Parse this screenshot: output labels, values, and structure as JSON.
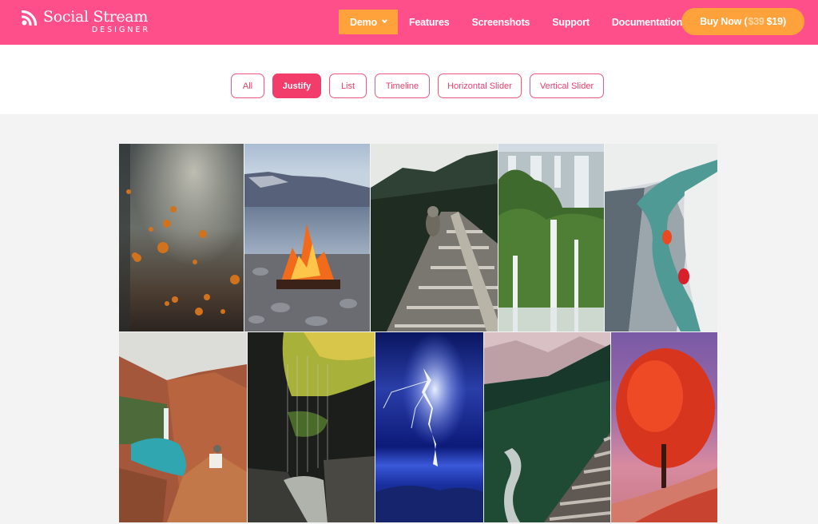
{
  "header": {
    "logo": {
      "title": "Social Stream",
      "subtitle": "DESIGNER",
      "icon": "rss-icon"
    },
    "nav": [
      {
        "label": "Demo",
        "has_dropdown": true,
        "active": true
      },
      {
        "label": "Features",
        "has_dropdown": false,
        "active": false
      },
      {
        "label": "Screenshots",
        "has_dropdown": false,
        "active": false
      },
      {
        "label": "Support",
        "has_dropdown": false,
        "active": false
      },
      {
        "label": "Documentation",
        "has_dropdown": true,
        "active": false
      }
    ],
    "buy": {
      "prefix": "Buy Now (",
      "old_price": "$39",
      "new_price": "$19",
      "suffix": ")"
    }
  },
  "filters": {
    "selected": "Justify",
    "items": [
      "All",
      "Justify",
      "List",
      "Timeline",
      "Horizontal Slider",
      "Vertical Slider"
    ]
  },
  "gallery": {
    "rows": [
      [
        {
          "subject": "falling autumn leaves in forest"
        },
        {
          "subject": "campfire by mountain lake"
        },
        {
          "subject": "person sitting on railway trestle bridge"
        },
        {
          "subject": "jungle waterfalls"
        },
        {
          "subject": "rafting through ice canyon"
        }
      ],
      [
        {
          "subject": "canyon waterfall with turquoise pool"
        },
        {
          "subject": "waterfall in rocky gorge"
        },
        {
          "subject": "lightning strike over sea"
        },
        {
          "subject": "pine forest and river with wooden bridge"
        },
        {
          "subject": "red autumn tree on hillside"
        }
      ]
    ]
  }
}
